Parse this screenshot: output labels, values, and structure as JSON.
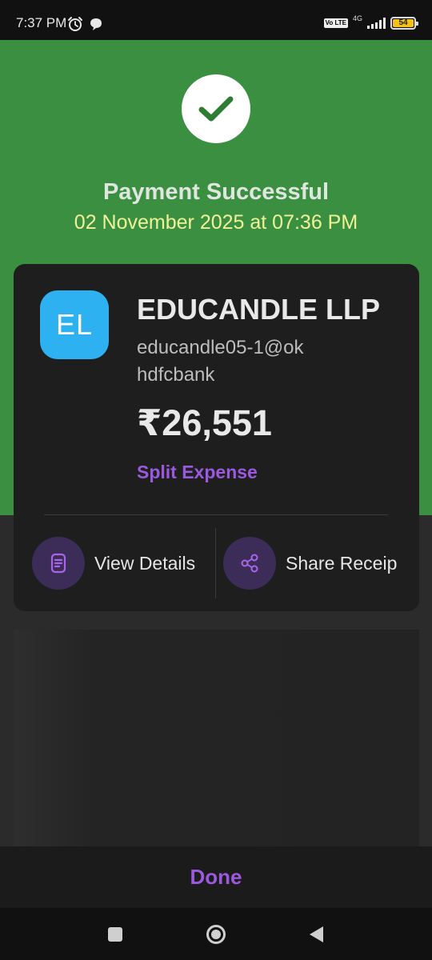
{
  "status_bar": {
    "time": "7:37 PM",
    "network_badge": "Vo LTE",
    "network_type": "4G",
    "battery_level": "54",
    "icons": [
      "alarm-icon",
      "chat-bubble-icon",
      "volte-icon",
      "signal-icon",
      "battery-icon"
    ]
  },
  "header": {
    "status_icon": "checkmark-icon",
    "title": "Payment Successful",
    "datetime": "02 November 2025 at 07:36 PM"
  },
  "payment": {
    "avatar_initials": "EL",
    "payee_name": "EDUCANDLE LLP",
    "upi_id": "educandle05-1@okhdfcbank",
    "amount": "₹26,551",
    "split_label": "Split Expense"
  },
  "actions": {
    "view_details": {
      "label": "View Details",
      "icon": "document-icon"
    },
    "share_receipt": {
      "label": "Share Receip",
      "icon": "share-icon"
    }
  },
  "footer": {
    "done_label": "Done"
  },
  "nav_bar": {
    "icons": [
      "recents-square-icon",
      "home-circle-icon",
      "back-triangle-icon"
    ]
  },
  "colors": {
    "success_green": "#3a9040",
    "accent_purple": "#9b59de",
    "date_yellow": "#f0f29a",
    "avatar_blue": "#2eb1f1",
    "card_bg": "#1e1e1f"
  }
}
